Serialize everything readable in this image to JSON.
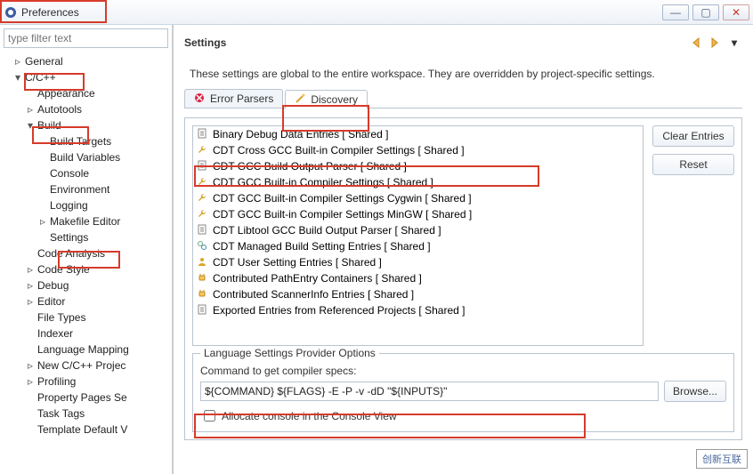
{
  "window": {
    "title": "Preferences"
  },
  "filter": {
    "placeholder": "type filter text"
  },
  "tree": {
    "general": "General",
    "ccpp": "C/C++",
    "appearance": "Appearance",
    "autotools": "Autotools",
    "build": "Build",
    "build_targets": "Build Targets",
    "build_variables": "Build Variables",
    "console": "Console",
    "environment": "Environment",
    "logging": "Logging",
    "makefile": "Makefile Editor",
    "settings": "Settings",
    "code_analysis": "Code Analysis",
    "code_style": "Code Style",
    "debug": "Debug",
    "editor": "Editor",
    "file_types": "File Types",
    "indexer": "Indexer",
    "lang_map": "Language Mapping",
    "new_proj": "New C/C++ Projec",
    "profiling": "Profiling",
    "prop_pages": "Property Pages Se",
    "task_tags": "Task Tags",
    "tmpl_default": "Template Default V"
  },
  "panel": {
    "heading": "Settings",
    "description": "These settings are global to the entire workspace.  They are overridden by project-specific settings."
  },
  "tabs": {
    "error_parsers": "Error Parsers",
    "discovery": "Discovery"
  },
  "providers": [
    {
      "icon": "page",
      "label": "Binary Debug Data Entries   [ Shared ]"
    },
    {
      "icon": "wrench",
      "label": "CDT Cross GCC Built-in Compiler Settings   [ Shared ]"
    },
    {
      "icon": "page",
      "label": "CDT GCC Build Output Parser   [ Shared ]"
    },
    {
      "icon": "wrench",
      "label": "CDT GCC Built-in Compiler Settings   [ Shared ]"
    },
    {
      "icon": "wrench",
      "label": "CDT GCC Built-in Compiler Settings Cygwin   [ Shared ]"
    },
    {
      "icon": "wrench",
      "label": "CDT GCC Built-in Compiler Settings MinGW   [ Shared ]"
    },
    {
      "icon": "page",
      "label": "CDT Libtool GCC Build Output Parser   [ Shared ]"
    },
    {
      "icon": "gears",
      "label": "CDT Managed Build Setting Entries   [ Shared ]"
    },
    {
      "icon": "person",
      "label": "CDT User Setting Entries   [ Shared ]"
    },
    {
      "icon": "plug",
      "label": "Contributed PathEntry Containers   [ Shared ]"
    },
    {
      "icon": "plug",
      "label": "Contributed ScannerInfo Entries   [ Shared ]"
    },
    {
      "icon": "page",
      "label": "Exported Entries from Referenced Projects   [ Shared ]"
    }
  ],
  "buttons": {
    "clear": "Clear Entries",
    "reset": "Reset",
    "browse": "Browse..."
  },
  "options": {
    "legend": "Language Settings Provider Options",
    "cmd_label": "Command to get compiler specs:",
    "cmd_value": "${COMMAND} ${FLAGS} -E -P -v -dD \"${INPUTS}\"",
    "allocate": "Allocate console in the Console View"
  },
  "watermark": "创新互联"
}
